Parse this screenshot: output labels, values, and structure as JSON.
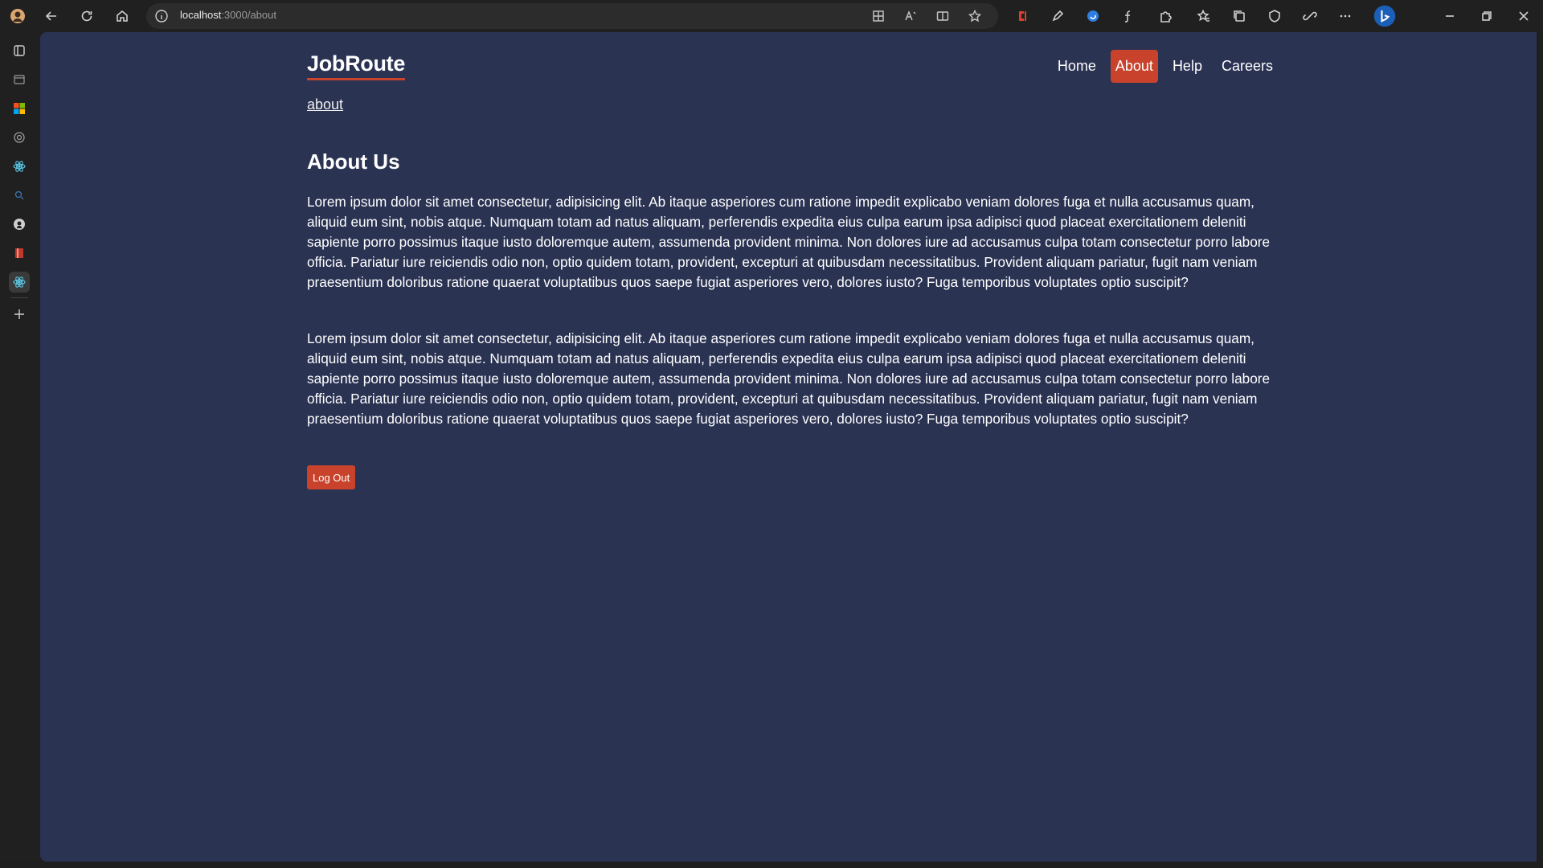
{
  "browser": {
    "url_host": "localhost",
    "url_path": ":3000/about"
  },
  "site": {
    "logo": "JobRoute",
    "nav": {
      "home": "Home",
      "about": "About",
      "help": "Help",
      "careers": "Careers"
    },
    "active_nav": "About",
    "accent_color": "#c9432c",
    "background_color": "#2b3353"
  },
  "page": {
    "breadcrumb": "about",
    "title": "About Us",
    "paragraphs": [
      "Lorem ipsum dolor sit amet consectetur, adipisicing elit. Ab itaque asperiores cum ratione impedit explicabo veniam dolores fuga et nulla accusamus quam, aliquid eum sint, nobis atque. Numquam totam ad natus aliquam, perferendis expedita eius culpa earum ipsa adipisci quod placeat exercitationem deleniti sapiente porro possimus itaque iusto doloremque autem, assumenda provident minima. Non dolores iure ad accusamus culpa totam consectetur porro labore officia. Pariatur iure reiciendis odio non, optio quidem totam, provident, excepturi at quibusdam necessitatibus. Provident aliquam pariatur, fugit nam veniam praesentium doloribus ratione quaerat voluptatibus quos saepe fugiat asperiores vero, dolores iusto? Fuga temporibus voluptates optio suscipit?",
      "Lorem ipsum dolor sit amet consectetur, adipisicing elit. Ab itaque asperiores cum ratione impedit explicabo veniam dolores fuga et nulla accusamus quam, aliquid eum sint, nobis atque. Numquam totam ad natus aliquam, perferendis expedita eius culpa earum ipsa adipisci quod placeat exercitationem deleniti sapiente porro possimus itaque iusto doloremque autem, assumenda provident minima. Non dolores iure ad accusamus culpa totam consectetur porro labore officia. Pariatur iure reiciendis odio non, optio quidem totam, provident, excepturi at quibusdam necessitatibus. Provident aliquam pariatur, fugit nam veniam praesentium doloribus ratione quaerat voluptatibus quos saepe fugiat asperiores vero, dolores iusto? Fuga temporibus voluptates optio suscipit?"
    ],
    "logout_label": "Log Out"
  }
}
